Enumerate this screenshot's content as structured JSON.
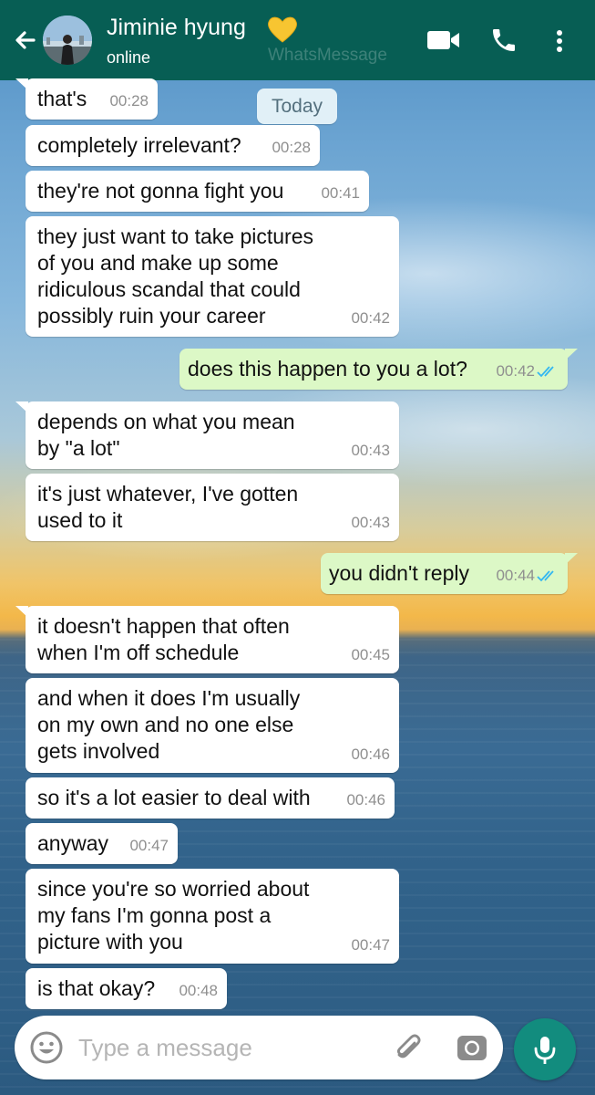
{
  "header": {
    "contact_name": "Jiminie hyung",
    "status": "online",
    "watermark": "WhatsMessage",
    "icons": [
      "back-arrow-icon",
      "yellow-heart-icon",
      "video-call-icon",
      "phone-icon",
      "more-vert-icon"
    ],
    "color": "#075e54"
  },
  "date_chip": "Today",
  "messages": [
    {
      "dir": "in",
      "text": "that's",
      "time": "00:28"
    },
    {
      "dir": "in",
      "text": "completely irrelevant?",
      "time": "00:28"
    },
    {
      "dir": "in",
      "text": "they're not gonna fight you",
      "time": "00:41"
    },
    {
      "dir": "in",
      "text": "they just want to take pictures\nof you and make up some\nridiculous scandal that could\npossibly ruin your career",
      "time": "00:42"
    },
    {
      "dir": "out",
      "text": "does this happen to you a lot?",
      "time": "00:42",
      "read": true
    },
    {
      "dir": "in",
      "text": "depends on what you mean\nby \"a lot\"",
      "time": "00:43"
    },
    {
      "dir": "in",
      "text": "it's just whatever, I've gotten\nused to it",
      "time": "00:43"
    },
    {
      "dir": "out",
      "text": "you didn't reply",
      "time": "00:44",
      "read": true
    },
    {
      "dir": "in",
      "text": "it doesn't happen that often\nwhen I'm off schedule",
      "time": "00:45"
    },
    {
      "dir": "in",
      "text": "and when it does I'm usually\non my own and no one else\ngets involved",
      "time": "00:46"
    },
    {
      "dir": "in",
      "text": "so it's a lot easier to deal with",
      "time": "00:46"
    },
    {
      "dir": "in",
      "text": "anyway",
      "time": "00:47"
    },
    {
      "dir": "in",
      "text": "since you're so worried about\nmy fans I'm gonna post a\npicture with you",
      "time": "00:47"
    },
    {
      "dir": "in",
      "text": "is that okay?",
      "time": "00:48"
    }
  ],
  "composer": {
    "placeholder": "Type a message",
    "value": "",
    "icons": [
      "emoji-icon",
      "attach-icon",
      "camera-icon",
      "mic-icon"
    ]
  },
  "colors": {
    "incoming_bubble": "#ffffff",
    "outgoing_bubble": "#dcf8c6",
    "read_ticks": "#34b7f1",
    "mic_button": "#128c7e"
  }
}
